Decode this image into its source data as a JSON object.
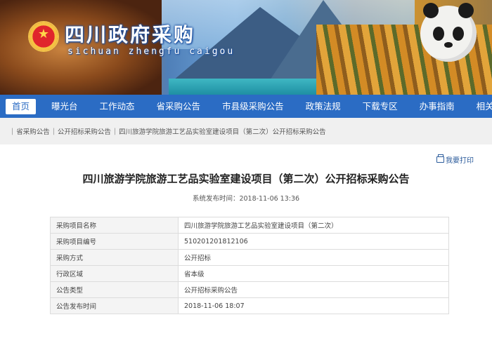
{
  "header": {
    "title": "四川政府采购",
    "subtitle": "sichuan zhengfu caigou",
    "emblem_icon": "national-emblem-icon"
  },
  "nav": {
    "items": [
      {
        "label": "首页",
        "active": true
      },
      {
        "label": "曝光台"
      },
      {
        "label": "工作动态"
      },
      {
        "label": "省采购公告"
      },
      {
        "label": "市县级采购公告"
      },
      {
        "label": "政策法规"
      },
      {
        "label": "下载专区"
      },
      {
        "label": "办事指南"
      },
      {
        "label": "相关模块"
      }
    ]
  },
  "breadcrumb": {
    "items": [
      "省采购公告",
      "公开招标采购公告",
      "四川旅游学院旅游工艺品实验室建设项目（第二次）公开招标采购公告"
    ]
  },
  "actions": {
    "print_label": "我要打印",
    "print_icon": "printer-icon"
  },
  "article": {
    "title": "四川旅游学院旅游工艺品实验室建设项目（第二次）公开招标采购公告",
    "publish_label": "系统发布时间：",
    "publish_time": "2018-11-06 13:36"
  },
  "info_table": {
    "rows": [
      {
        "key": "采购项目名称",
        "value": "四川旅游学院旅游工艺品实验室建设项目（第二次）"
      },
      {
        "key": "采购项目编号",
        "value": "510201201812106"
      },
      {
        "key": "采购方式",
        "value": "公开招标"
      },
      {
        "key": "行政区域",
        "value": "省本级"
      },
      {
        "key": "公告类型",
        "value": "公开招标采购公告"
      },
      {
        "key": "公告发布时间",
        "value": "2018-11-06 18:07"
      }
    ]
  },
  "colors": {
    "nav_bg": "#2b6cc4",
    "breadcrumb_bg": "#f0f0f0",
    "table_key_bg": "#f4f4f4"
  }
}
